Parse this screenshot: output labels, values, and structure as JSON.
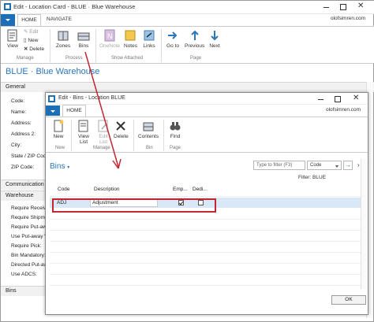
{
  "window": {
    "title": "Edit - Location Card - BLUE · Blue Warehouse"
  },
  "tabs": {
    "home": "HOME",
    "navigate": "NAVIGATE"
  },
  "ribbon": {
    "view": "View",
    "edit": "Edit",
    "new": "New",
    "delete": "Delete",
    "manage": "Manage",
    "zones": "Zones",
    "bins": "Bins",
    "process": "Process",
    "onenote": "OneNote",
    "notes": "Notes",
    "links": "Links",
    "show_attached": "Show Attached",
    "go_to": "Go to",
    "previous": "Previous",
    "next": "Next",
    "page": "Page",
    "user": "olofsimren.com"
  },
  "page": {
    "heading": "BLUE · Blue Warehouse"
  },
  "general": {
    "section": "General",
    "fields": [
      "Code:",
      "Name:",
      "Address:",
      "Address 2:",
      "City:",
      "State / ZIP Code:",
      "ZIP Code:"
    ]
  },
  "communication": {
    "section": "Communication"
  },
  "warehouse": {
    "section": "Warehouse",
    "fields": [
      "Require Receive:",
      "Require Shipment:",
      "Require Put-away:",
      "Use Put-away W",
      "Require Pick:",
      "Bin Mandatory:",
      "Directed Put-away:",
      "Use ADCS:"
    ]
  },
  "bins_section": {
    "section": "Bins"
  },
  "dialog": {
    "title": "Edit - Bins - Location BLUE",
    "home_tab": "HOME",
    "user": "olofsimren.com",
    "new": "New",
    "view_list": "View List",
    "edit_list": "Edit List",
    "delete": "Delete",
    "contents": "Contents",
    "find": "Find",
    "grp_new": "New",
    "grp_manage": "Manage",
    "grp_bin": "Bin",
    "grp_page": "Page",
    "list_title": "Bins",
    "filter_placeholder": "Type to filter (F3)",
    "filter_field": "Code",
    "filter_info": "Filter: BLUE",
    "col_code": "Code",
    "col_description": "Description",
    "col_empty": "Emp...",
    "col_dedicated": "Dedi...",
    "rows": [
      {
        "code": "ADJ",
        "description": "Adjustment",
        "empty": true,
        "dedicated": false
      }
    ],
    "ok": "OK"
  },
  "colors": {
    "accent": "#2b76b8",
    "highlight": "#c42533",
    "row_selected": "#d8e8f7"
  }
}
